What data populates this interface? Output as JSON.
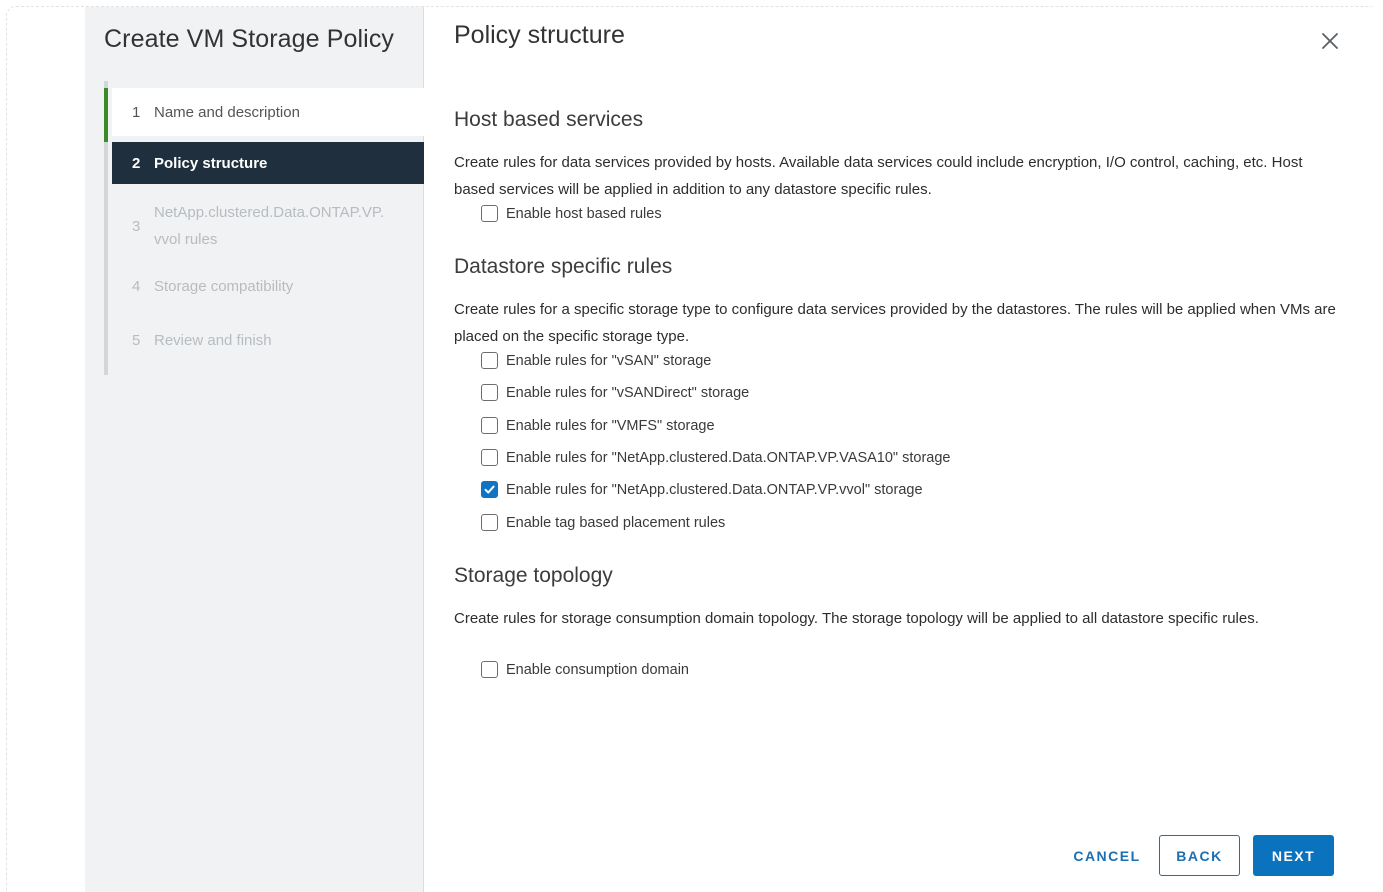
{
  "wizard": {
    "title": "Create VM Storage Policy",
    "steps": [
      {
        "num": "1",
        "label": "Name and description",
        "state": "done"
      },
      {
        "num": "2",
        "label": "Policy structure",
        "state": "current"
      },
      {
        "num": "3",
        "label": "NetApp.clustered.Data.ONTAP.VP.\nvvol rules",
        "label_line1": "NetApp.clustered.Data.ONTAP.VP.",
        "label_line2": "vvol rules",
        "state": "disabled"
      },
      {
        "num": "4",
        "label": "Storage compatibility",
        "state": "disabled"
      },
      {
        "num": "5",
        "label": "Review and finish",
        "state": "disabled"
      }
    ]
  },
  "page": {
    "title": "Policy structure",
    "close_icon": "close-icon"
  },
  "host_services": {
    "title": "Host based services",
    "description": "Create rules for data services provided by hosts. Available data services could include encryption, I/O control, caching, etc. Host based services will be applied in addition to any datastore specific rules.",
    "options": [
      {
        "label": "Enable host based rules",
        "checked": false
      }
    ]
  },
  "datastore_rules": {
    "title": "Datastore specific rules",
    "description": "Create rules for a specific storage type to configure data services provided by the datastores. The rules will be applied when VMs are placed on the specific storage type.",
    "options": [
      {
        "label": "Enable rules for \"vSAN\" storage",
        "checked": false
      },
      {
        "label": "Enable rules for \"vSANDirect\" storage",
        "checked": false
      },
      {
        "label": "Enable rules for \"VMFS\" storage",
        "checked": false
      },
      {
        "label": "Enable rules for \"NetApp.clustered.Data.ONTAP.VP.VASA10\" storage",
        "checked": false
      },
      {
        "label": "Enable rules for \"NetApp.clustered.Data.ONTAP.VP.vvol\" storage",
        "checked": true
      },
      {
        "label": "Enable tag based placement rules",
        "checked": false
      }
    ]
  },
  "storage_topology": {
    "title": "Storage topology",
    "description": "Create rules for storage consumption domain topology. The storage topology will be applied to all datastore specific rules.",
    "options": [
      {
        "label": "Enable consumption domain",
        "checked": false
      }
    ]
  },
  "footer": {
    "cancel_label": "CANCEL",
    "back_label": "BACK",
    "next_label": "NEXT"
  },
  "colors": {
    "accent": "#0b72bd",
    "nav_current_bg": "#1f2f3d",
    "step_done_bar": "#3a8a2a"
  }
}
